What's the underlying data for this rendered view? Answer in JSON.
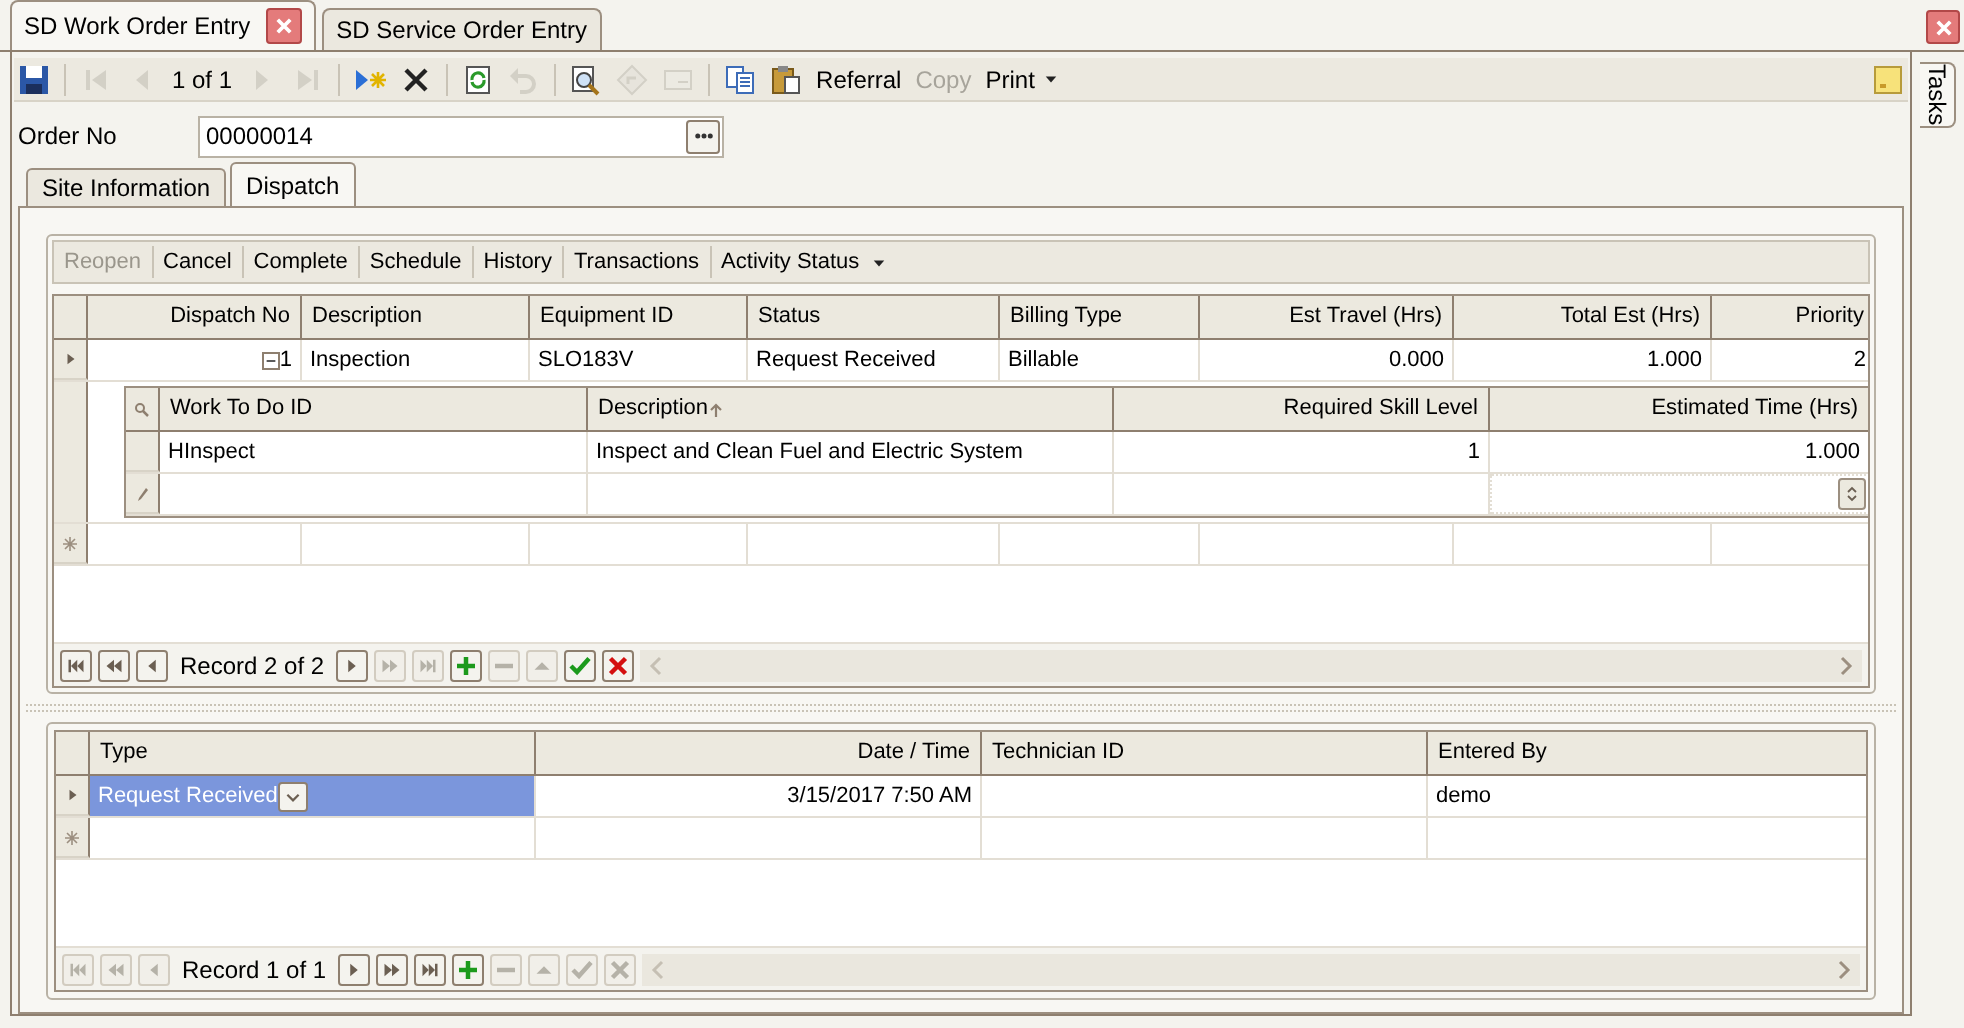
{
  "document_tabs": [
    {
      "label": "SD Work Order Entry",
      "selected": true
    },
    {
      "label": "SD Service Order Entry",
      "selected": false
    }
  ],
  "toolbar": [
    {
      "kind": "save",
      "disabled": false
    },
    {
      "kind": "separator"
    },
    {
      "kind": "first",
      "disabled": true
    },
    {
      "kind": "prev",
      "disabled": true
    },
    {
      "kind": "position",
      "text": "1 of 1"
    },
    {
      "kind": "next",
      "disabled": true
    },
    {
      "kind": "last",
      "disabled": true
    },
    {
      "kind": "separator"
    },
    {
      "kind": "new",
      "disabled": false
    },
    {
      "kind": "delete",
      "disabled": false
    },
    {
      "kind": "separator"
    },
    {
      "kind": "refresh",
      "disabled": false
    },
    {
      "kind": "undo",
      "disabled": true
    },
    {
      "kind": "separator"
    },
    {
      "kind": "preview",
      "disabled": false
    },
    {
      "kind": "goto",
      "disabled": true
    },
    {
      "kind": "mail",
      "disabled": true
    },
    {
      "kind": "separator"
    },
    {
      "kind": "copy",
      "disabled": false
    },
    {
      "kind": "paste",
      "disabled": false
    },
    {
      "kind": "text",
      "label": "Referral",
      "disabled": false
    },
    {
      "kind": "text",
      "label": "Copy",
      "disabled": true
    },
    {
      "kind": "menu",
      "label": "Print",
      "disabled": false
    }
  ],
  "order_no": {
    "label": "Order No",
    "value": "00000014"
  },
  "form_tabs": [
    {
      "label": "Site Information",
      "selected": false
    },
    {
      "label": "Dispatch",
      "selected": true
    }
  ],
  "action_bar": [
    {
      "label": "Reopen",
      "disabled": true,
      "dropdown": false
    },
    {
      "label": "Cancel",
      "disabled": false,
      "dropdown": false
    },
    {
      "label": "Complete",
      "disabled": false,
      "dropdown": false
    },
    {
      "label": "Schedule",
      "disabled": false,
      "dropdown": false
    },
    {
      "label": "History",
      "disabled": false,
      "dropdown": false
    },
    {
      "label": "Transactions",
      "disabled": false,
      "dropdown": false
    },
    {
      "label": "Activity Status",
      "disabled": false,
      "dropdown": true
    }
  ],
  "dispatch_grid": {
    "columns": [
      {
        "label": "Dispatch No"
      },
      {
        "label": "Description"
      },
      {
        "label": "Equipment ID"
      },
      {
        "label": "Status"
      },
      {
        "label": "Billing Type"
      },
      {
        "label": "Est Travel (Hrs)"
      },
      {
        "label": "Total Est (Hrs)"
      },
      {
        "label": "Priority"
      }
    ],
    "rows": [
      {
        "current": true,
        "new_row": false,
        "expanded": true,
        "cells": [
          "1",
          "Inspection",
          "SLO183V",
          "Request Received",
          "Billable",
          "0.000",
          "1.000",
          "2"
        ],
        "detail": {
          "columns": [
            {
              "label": "Work To Do ID",
              "sorted": false
            },
            {
              "label": "Description",
              "sorted": true
            },
            {
              "label": "Required Skill Level",
              "sorted": false
            },
            {
              "label": "Estimated Time (Hrs)",
              "sorted": false
            }
          ],
          "rows": [
            {
              "editing": false,
              "cells": [
                "HInspect",
                "Inspect and Clean Fuel and Electric System",
                "1",
                "1.000"
              ]
            },
            {
              "editing": true
            }
          ]
        }
      },
      {
        "current": false,
        "new_row": true
      }
    ]
  },
  "dispatch_navigator": {
    "text": "Record 2 of 2",
    "buttons": [
      {
        "kind": "first",
        "disabled": false
      },
      {
        "kind": "prev_page",
        "disabled": false
      },
      {
        "kind": "prev",
        "disabled": false
      },
      {
        "kind": "text"
      },
      {
        "kind": "next",
        "disabled": false
      },
      {
        "kind": "next_page",
        "disabled": true
      },
      {
        "kind": "last",
        "disabled": true
      },
      {
        "kind": "add",
        "disabled": false
      },
      {
        "kind": "remove",
        "disabled": true
      },
      {
        "kind": "up",
        "disabled": true
      },
      {
        "kind": "accept",
        "disabled": false
      },
      {
        "kind": "cancel",
        "disabled": false
      }
    ]
  },
  "activity_grid": {
    "columns": [
      {
        "label": "Type"
      },
      {
        "label": "Date / Time"
      },
      {
        "label": "Technician ID"
      },
      {
        "label": "Entered By"
      }
    ],
    "rows": [
      {
        "current": true,
        "new_row": false,
        "selected": true,
        "cells": [
          "Request Received",
          "3/15/2017 7:50 AM",
          null,
          "demo"
        ]
      },
      {
        "current": false,
        "new_row": true,
        "selected": false
      }
    ]
  },
  "activity_navigator": {
    "text": "Record 1 of 1",
    "buttons": [
      {
        "kind": "first",
        "disabled": true
      },
      {
        "kind": "prev_page",
        "disabled": true
      },
      {
        "kind": "prev",
        "disabled": true
      },
      {
        "kind": "text"
      },
      {
        "kind": "next",
        "disabled": false
      },
      {
        "kind": "next_page",
        "disabled": false
      },
      {
        "kind": "last",
        "disabled": false
      },
      {
        "kind": "add",
        "disabled": false
      },
      {
        "kind": "remove",
        "disabled": true
      },
      {
        "kind": "up",
        "disabled": true
      },
      {
        "kind": "accept",
        "disabled": true
      },
      {
        "kind": "cancel",
        "disabled": true
      }
    ]
  },
  "side_tabs": [
    {
      "label": "Tasks"
    }
  ]
}
